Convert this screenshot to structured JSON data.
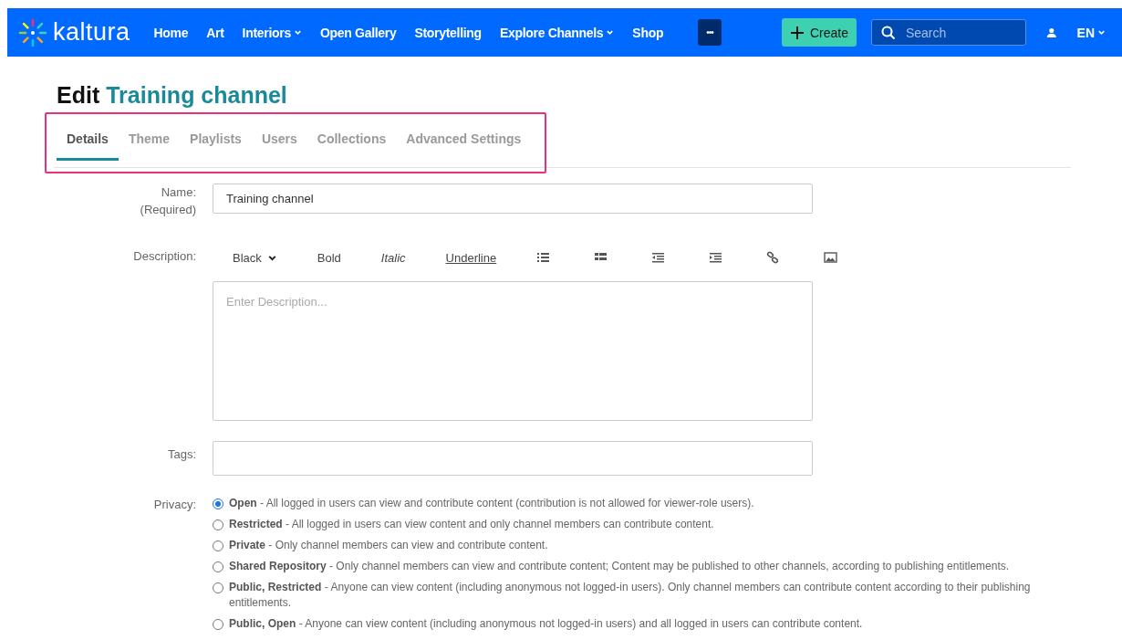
{
  "header": {
    "logo": "kaltura",
    "nav": [
      {
        "label": "Home",
        "dropdown": false
      },
      {
        "label": "Art",
        "dropdown": false
      },
      {
        "label": "Interiors",
        "dropdown": true
      },
      {
        "label": "Open Gallery",
        "dropdown": false
      },
      {
        "label": "Storytelling",
        "dropdown": false
      },
      {
        "label": "Explore Channels",
        "dropdown": true
      },
      {
        "label": "Shop",
        "dropdown": false
      }
    ],
    "more": "•••",
    "create": "Create",
    "search": {
      "placeholder": "Search"
    },
    "language": "EN"
  },
  "page": {
    "title_prefix": "Edit",
    "title_name": "Training channel"
  },
  "tabs": [
    {
      "label": "Details",
      "selected": true
    },
    {
      "label": "Theme",
      "selected": false
    },
    {
      "label": "Playlists",
      "selected": false
    },
    {
      "label": "Users",
      "selected": false
    },
    {
      "label": "Collections",
      "selected": false
    },
    {
      "label": "Advanced Settings",
      "selected": false
    }
  ],
  "form": {
    "name": {
      "label": "Name:",
      "required": "(Required)",
      "value": "Training channel"
    },
    "description": {
      "label": "Description:",
      "placeholder": "Enter Description...",
      "toolbar": [
        {
          "kind": "select",
          "label": "Black"
        },
        {
          "kind": "plain",
          "label": "Bold"
        },
        {
          "kind": "italic",
          "label": "Italic"
        },
        {
          "kind": "underline",
          "label": "Underline"
        }
      ]
    },
    "tags": {
      "label": "Tags:"
    },
    "privacy": {
      "label": "Privacy:",
      "options": [
        {
          "text": "**Open** - All logged in users can view and contribute content (contribution is not allowed for viewer-role users).",
          "selected": true
        },
        {
          "text": "**Restricted** - All logged in users can view content and only channel members can contribute content.",
          "selected": false
        },
        {
          "text": "**Private** - Only channel members can view and contribute content.",
          "selected": false
        },
        {
          "text": "**Shared Repository** - Only channel members can view and contribute content; Content may be published to other channels, according to publishing entitlements.",
          "selected": false
        },
        {
          "text": "**Public, Restricted** - Anyone can view content (including anonymous not logged-in users). Only channel members can contribute content according to their publishing entitlements.",
          "selected": false
        },
        {
          "text": "**Public, Open** - Anyone can view content (including anonymous not logged-in users) and all logged in users can contribute content.",
          "selected": false
        }
      ]
    }
  }
}
